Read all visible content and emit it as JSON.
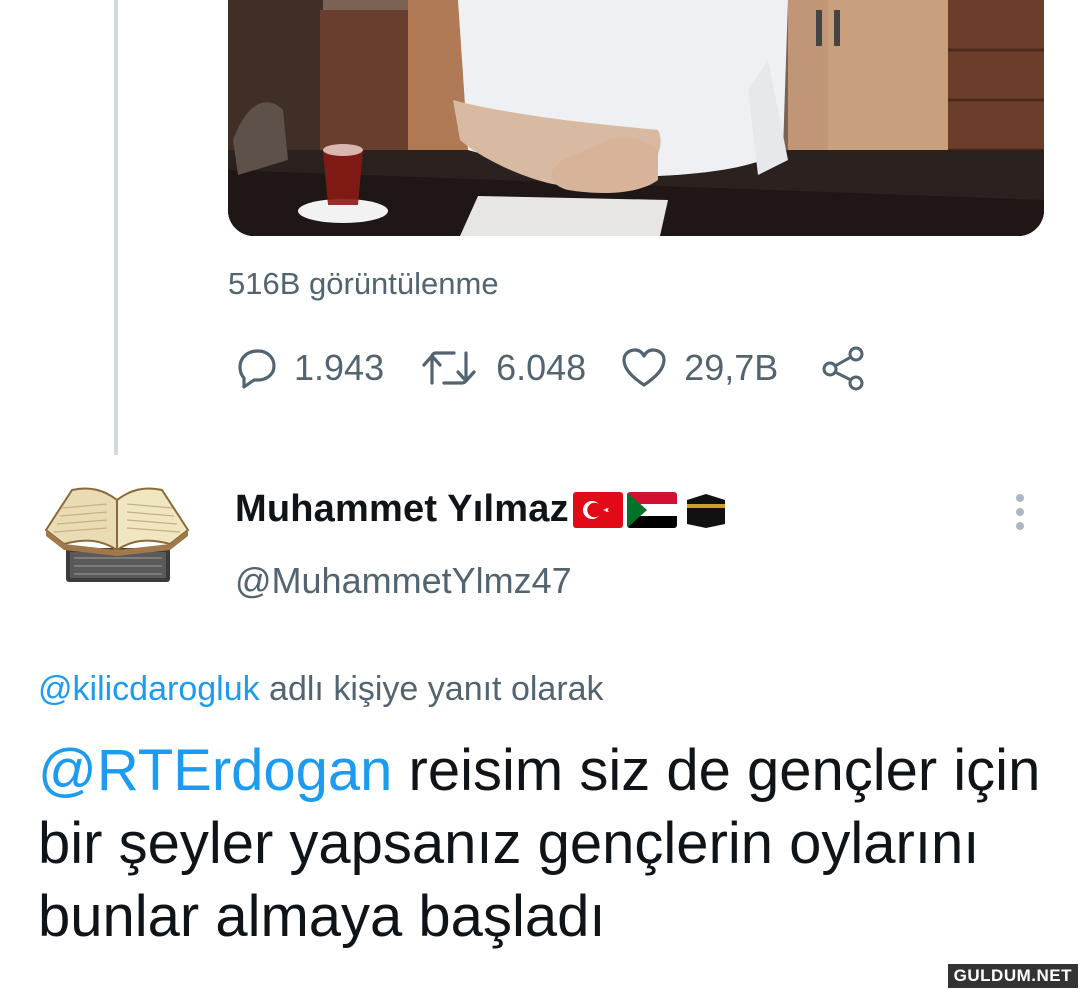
{
  "previous_tweet": {
    "video_description": "video thumbnail",
    "views_text": "516B görüntülenme",
    "stats": {
      "replies": "1.943",
      "retweets": "6.048",
      "likes": "29,7B"
    },
    "icons": [
      "reply-icon",
      "retweet-icon",
      "like-icon",
      "share-icon"
    ]
  },
  "reply_tweet": {
    "display_name": "Muhammet Yılmaz",
    "flags": [
      "turkey-flag",
      "sudan-flag",
      "kaaba-emoji"
    ],
    "handle": "@MuhammetYlmz47",
    "reply_context": {
      "mention": "@kilicdarogluk",
      "text": " adlı kişiye yanıt olarak"
    },
    "text_mention": "@RTErdogan",
    "text_body": " reisim siz de gençler için bir şeyler yapsanız gençlerin oylarını bunlar almaya başladı"
  },
  "watermark": "GULDUM.NET",
  "colors": {
    "accent": "#1d9bf0",
    "secondary_text": "#536471",
    "primary_text": "#0f1419"
  }
}
